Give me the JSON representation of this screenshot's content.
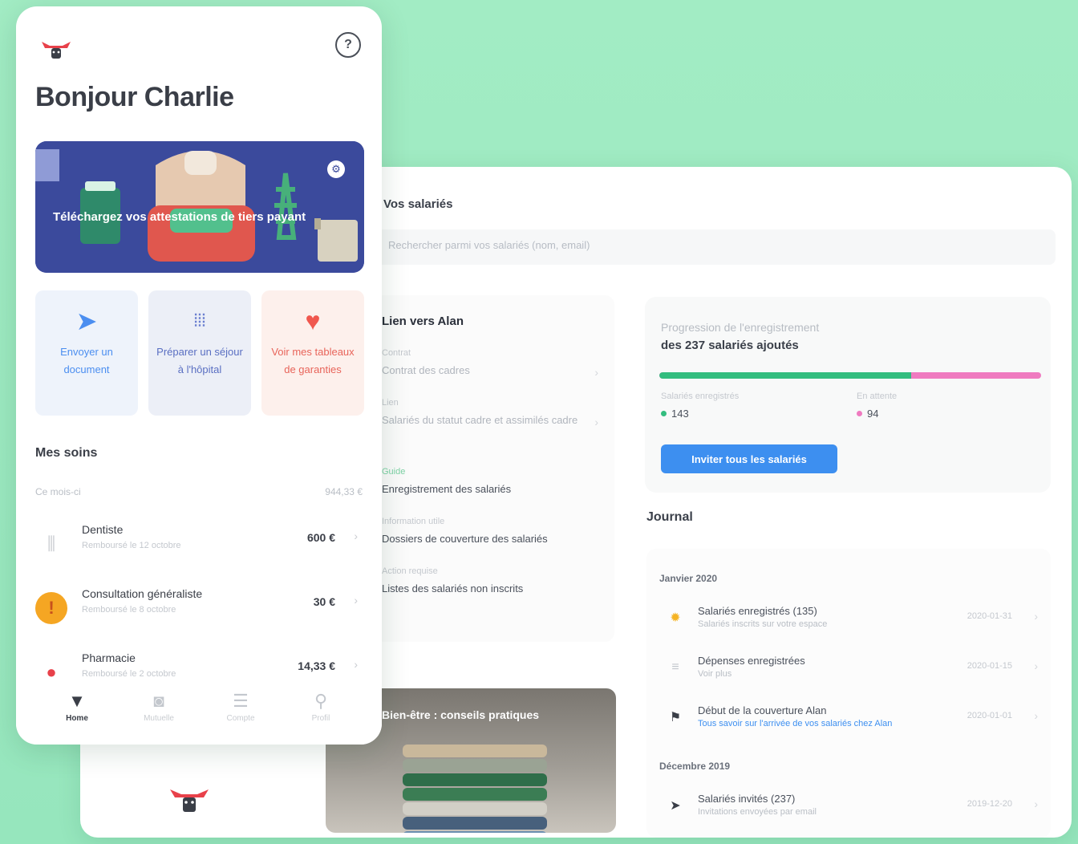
{
  "colors": {
    "background": "#9be9c1",
    "accent_green": "#33bd7f",
    "accent_pink": "#ef7bc0",
    "accent_blue": "#3d8ff0",
    "banner": "#3b4a9c"
  },
  "phone": {
    "logo_icon": "bull-logo-icon",
    "help_icon": "?",
    "greeting": "Bonjour Charlie",
    "banner": {
      "text": "Téléchargez vos attestations de tiers payant",
      "gear_icon": "⚙"
    },
    "actions": [
      {
        "icon": "paper-plane-icon",
        "glyph": "➤",
        "label": "Envoyer un document"
      },
      {
        "icon": "bars-icon",
        "glyph": "⦙⦙⦙",
        "label": "Préparer un séjour à l'hôpital"
      },
      {
        "icon": "heart-icon",
        "glyph": "♥",
        "label": "Voir mes tableaux de garanties"
      }
    ],
    "care_section": {
      "title": "Mes soins",
      "subtitle": "Ce mois-ci",
      "total": "944,33 €",
      "items": [
        {
          "icon": "tooth-icon",
          "glyph": "⫼",
          "title": "Dentiste",
          "desc": "Remboursé le 12 octobre",
          "amount": "600 €"
        },
        {
          "icon": "doctor-icon",
          "glyph": "!",
          "title": "Consultation généraliste",
          "desc": "Remboursé le 8 octobre",
          "amount": "30 €"
        },
        {
          "icon": "pill-icon",
          "glyph": "●",
          "title": "Pharmacie",
          "desc": "Remboursé le 2 octobre",
          "amount": "14,33 €"
        }
      ]
    },
    "tabs": [
      {
        "icon": "home-icon",
        "glyph": "▼",
        "label": "Home"
      },
      {
        "icon": "wallet-icon",
        "glyph": "◙",
        "label": "Mutuelle"
      },
      {
        "icon": "list-icon",
        "glyph": "☰",
        "label": "Compte"
      },
      {
        "icon": "profile-icon",
        "glyph": "⚲",
        "label": "Profil"
      }
    ]
  },
  "web": {
    "title": "Vos salariés",
    "search_placeholder": "Rechercher parmi vos salariés (nom, email)",
    "link_panel": {
      "title": "Lien vers Alan",
      "fields": [
        {
          "label": "Contrat",
          "value": "Contrat des cadres",
          "style": "muted"
        },
        {
          "label": "Lien",
          "value": "Salariés du statut cadre et assimilés cadre",
          "style": "muted"
        },
        {
          "label": "Guide",
          "value": "Enregistrement des salariés",
          "style": "dark",
          "label_style": "green"
        },
        {
          "label": "Information utile",
          "value": "Dossiers de couverture des salariés",
          "style": "dark"
        },
        {
          "label": "Action requise",
          "value": "Listes des salariés non inscrits",
          "style": "dark"
        }
      ]
    },
    "progress": {
      "subtitle": "Progression de l'enregistrement",
      "title": "des 237 salariés ajoutés",
      "registered_fraction": 0.66,
      "stats": [
        {
          "label": "Salariés enregistrés",
          "value": "143",
          "color": "#33bd7f"
        },
        {
          "label": "En attente",
          "value": "94",
          "color": "#ef7bc0"
        }
      ],
      "button_label": "Inviter tous les salariés"
    },
    "journal": {
      "title": "Journal",
      "months": [
        {
          "label": "Janvier 2020",
          "entries": [
            {
              "icon": "sun-icon",
              "glyph": "✹",
              "icon_color": "#f5b323",
              "title": "Salariés enregistrés (135)",
              "desc": "Salariés inscrits sur votre espace",
              "date": "2020-01-31",
              "link": false
            },
            {
              "icon": "coins-icon",
              "glyph": "≡",
              "icon_color": "#c3c7cd",
              "title": "Dépenses enregistrées",
              "desc": "Voir plus",
              "date": "2020-01-15",
              "link": false
            },
            {
              "icon": "flag-icon",
              "glyph": "⚑",
              "icon_color": "#3a3e47",
              "title": "Début de la couverture Alan",
              "desc": "Tous savoir sur l'arrivée de vos salariés chez Alan",
              "date": "2020-01-01",
              "link": true
            }
          ]
        },
        {
          "label": "Décembre 2019",
          "entries": [
            {
              "icon": "send-icon",
              "glyph": "➤",
              "icon_color": "#3a3e47",
              "title": "Salariés invités (237)",
              "desc": "Invitations envoyées par email",
              "date": "2019-12-20",
              "link": false
            }
          ]
        }
      ]
    },
    "photo_caption": "Bien-être : conseils pratiques"
  }
}
